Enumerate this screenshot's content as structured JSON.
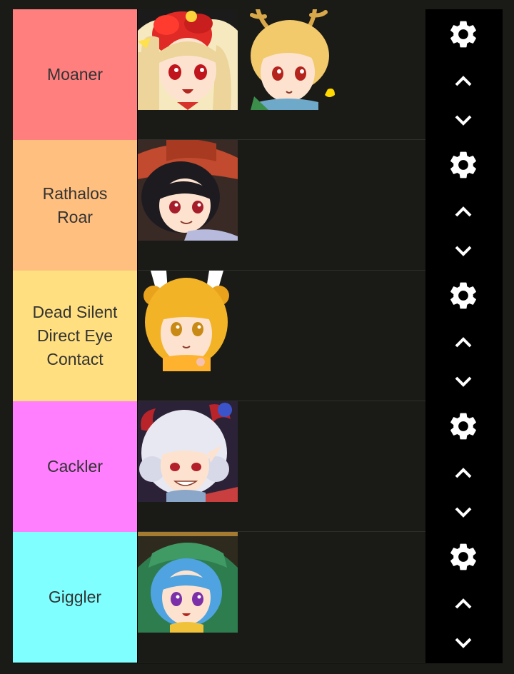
{
  "tiers": [
    {
      "id": "moaner",
      "label_lines": [
        "Moaner"
      ],
      "color": "#ff7f7f",
      "items": [
        "character-1",
        "character-2"
      ]
    },
    {
      "id": "rathalos",
      "label_lines": [
        "Rathalos",
        "Roar"
      ],
      "color": "#ffbf7f",
      "items": [
        "character-3"
      ]
    },
    {
      "id": "dead-silent",
      "label_lines": [
        "Dead Silent",
        "Direct Eye",
        "Contact"
      ],
      "color": "#ffdf7f",
      "items": [
        "character-4"
      ]
    },
    {
      "id": "cackler",
      "label_lines": [
        "Cackler"
      ],
      "color": "#ff7fff",
      "items": [
        "character-5"
      ]
    },
    {
      "id": "giggler",
      "label_lines": [
        "Giggler"
      ],
      "color": "#7fffff",
      "items": [
        "character-6"
      ]
    }
  ],
  "controls": {
    "settings_icon": "gear-icon",
    "move_up_icon": "chevron-up-icon",
    "move_down_icon": "chevron-down-icon"
  },
  "colors": {
    "page_bg": "#1a1a17",
    "controls_bg": "#000000",
    "label_text": "#333333",
    "icon": "#ffffff"
  }
}
